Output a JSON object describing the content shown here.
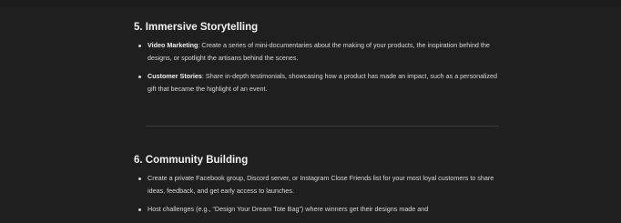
{
  "section1": {
    "title": "5. Immersive Storytelling",
    "items": [
      {
        "label": "Video Marketing",
        "text": ": Create a series of mini-documentaries about the making of your products, the inspiration behind the designs, or spotlight the artisans behind the scenes."
      },
      {
        "label": "Customer Stories",
        "text": ": Share in-depth testimonials, showcasing how a product has made an impact, such as a personalized gift that became the highlight of an event."
      }
    ]
  },
  "section2": {
    "title": "6. Community Building",
    "items": [
      {
        "text": "Create a private Facebook group, Discord server, or Instagram Close Friends list for your most loyal customers to share ideas, feedback, and get early access to launches."
      },
      {
        "text": "Host challenges (e.g., “Design Your Dream Tote Bag”) where winners get their designs made and"
      }
    ]
  }
}
